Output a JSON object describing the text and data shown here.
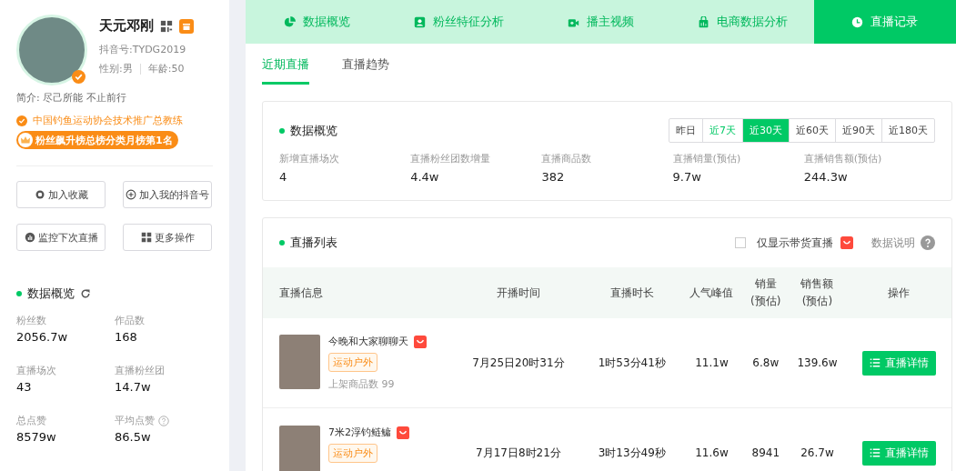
{
  "profile": {
    "name": "天元邓刚",
    "douyin_id": "抖音号:TYDG2019",
    "gender": "性别:男",
    "age": "年龄:50",
    "verified": true,
    "bio": "简介: 尽己所能 不止前行",
    "certification": "中国钓鱼运动协会技术推广总教练",
    "rank_badge": "粉丝飙升榜总榜分类月榜第1名"
  },
  "actions": [
    {
      "label": "加入收藏"
    },
    {
      "label": "加入我的抖音号"
    },
    {
      "label": "监控下次直播"
    },
    {
      "label": "更多操作"
    }
  ],
  "overview": {
    "title": "数据概览",
    "stats": [
      {
        "label": "粉丝数",
        "value": "2056.7w",
        "help": false
      },
      {
        "label": "作品数",
        "value": "168",
        "help": false
      },
      {
        "label": "直播场次",
        "value": "43",
        "help": false
      },
      {
        "label": "直播粉丝团",
        "value": "14.7w",
        "help": false
      },
      {
        "label": "总点赞",
        "value": "8579w",
        "help": false
      },
      {
        "label": "平均点赞",
        "value": "86.5w",
        "help": true
      }
    ]
  },
  "nav_tabs": [
    {
      "label": "数据概览",
      "selected": false
    },
    {
      "label": "粉丝特征分析",
      "selected": false
    },
    {
      "label": "播主视频",
      "selected": false
    },
    {
      "label": "电商数据分析",
      "selected": false
    },
    {
      "label": "直播记录",
      "selected": true
    }
  ],
  "sub_tabs": [
    {
      "label": "近期直播",
      "selected": true
    },
    {
      "label": "直播趋势",
      "selected": false
    }
  ],
  "live_overview": {
    "title": "数据概览",
    "periods": [
      {
        "label": "昨日",
        "selected": false,
        "hovered": false
      },
      {
        "label": "近7天",
        "selected": false,
        "hovered": true
      },
      {
        "label": "近30天",
        "selected": true,
        "hovered": false
      },
      {
        "label": "近60天",
        "selected": false,
        "hovered": false
      },
      {
        "label": "近90天",
        "selected": false,
        "hovered": false
      },
      {
        "label": "近180天",
        "selected": false,
        "hovered": false
      }
    ],
    "stats": [
      {
        "label": "新增直播场次",
        "value": "4"
      },
      {
        "label": "直播粉丝团数增量",
        "value": "4.4w"
      },
      {
        "label": "直播商品数",
        "value": "382"
      },
      {
        "label": "直播销量(预估)",
        "value": "9.7w"
      },
      {
        "label": "直播销售额(预估)",
        "value": "244.3w"
      }
    ]
  },
  "live_list": {
    "title": "直播列表",
    "filter": {
      "label": "仅显示带货直播",
      "checked": false
    },
    "help_label": "数据说明",
    "columns": [
      "直播信息",
      "开播时间",
      "直播时长",
      "人气峰值",
      "销量\n(预估)",
      "销售额\n(预估)",
      "操作"
    ],
    "rows": [
      {
        "title": "今晚和大家聊聊天",
        "shop": true,
        "tag": "运动户外",
        "product_count": "上架商品数 99",
        "start": "7月25日20时31分",
        "duration": "1时53分41秒",
        "peak": "11.1w",
        "sales": "6.8w",
        "revenue": "139.6w",
        "action": "直播详情"
      },
      {
        "title": "7米2浮钓鲢鳙",
        "shop": true,
        "tag": "运动户外",
        "start": "7月17日8时21分",
        "duration": "3时13分49秒",
        "peak": "11.6w",
        "sales": "8941",
        "revenue": "26.7w",
        "action": "直播详情"
      }
    ]
  }
}
